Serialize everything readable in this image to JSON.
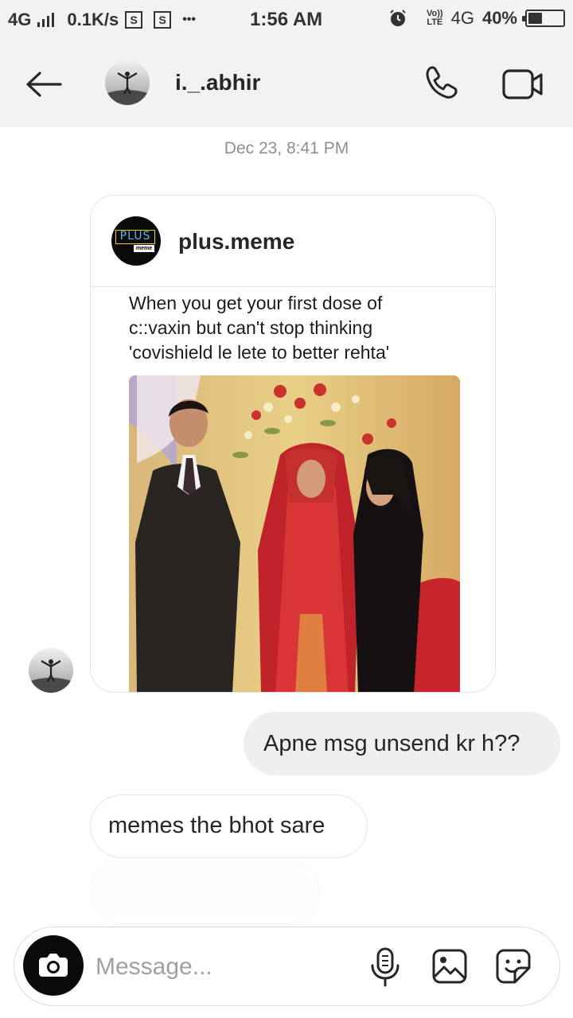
{
  "status_bar": {
    "network": "4G",
    "speed": "0.1K/s",
    "s_icon": "S",
    "dots": "•••",
    "time": "1:56 AM",
    "volte_top": "Vo))",
    "volte_bottom": "LTE",
    "network_right": "4G",
    "battery_text": "40%",
    "battery_level": 0.4
  },
  "header": {
    "username": "i._.abhir",
    "icons": [
      "back-arrow-icon",
      "phone-icon",
      "video-camera-icon"
    ]
  },
  "chat": {
    "timestamp": "Dec 23, 8:41 PM",
    "shared_post": {
      "username": "plus.meme",
      "logo_text": "PLUS",
      "logo_subtext": "meme",
      "caption_lines": [
        "When you get your first dose of",
        "c::vaxin but can't stop thinking",
        "'covishield le lete to better rehta'"
      ]
    },
    "messages": [
      {
        "direction": "outgoing",
        "text": "Apne msg unsend kr h??"
      },
      {
        "direction": "incoming",
        "text": "memes the bhot sare"
      }
    ]
  },
  "composer": {
    "placeholder": "Message...",
    "icons": [
      "camera-icon",
      "microphone-icon",
      "gallery-icon",
      "sticker-icon"
    ]
  },
  "colors": {
    "background": "#ffffff",
    "header_bg": "#f2f2f2",
    "outgoing_bubble": "#efefef",
    "muted_text": "#8e8e8e"
  }
}
